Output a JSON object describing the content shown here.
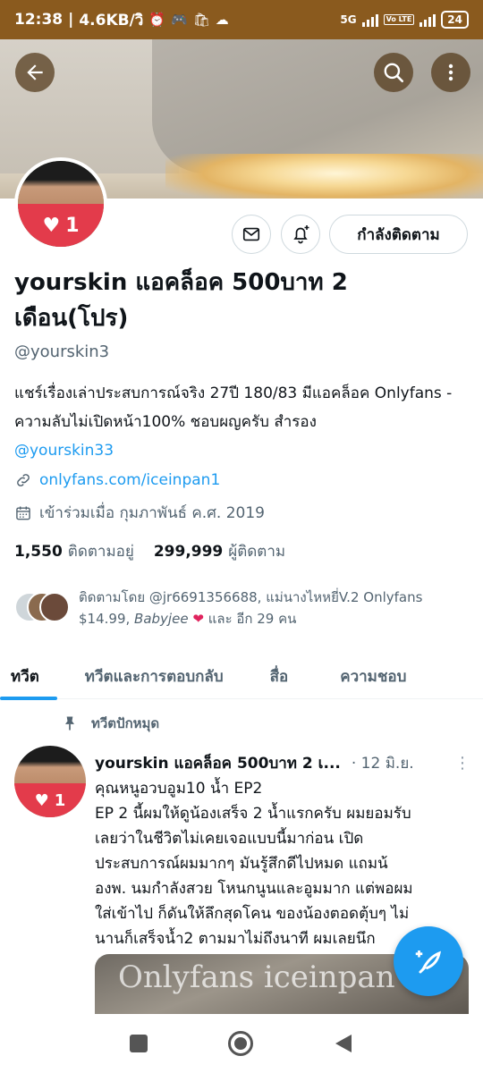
{
  "status_bar": {
    "time": "12:38",
    "data_speed": "4.6KB/วิ",
    "network_label": "5G",
    "volte_label": "Vo LTE",
    "battery": "24"
  },
  "profile": {
    "display_name": "yourskin แอคล็อค 500บาท 2 เดือน(โปร)",
    "handle": "@yourskin3",
    "bio_text": "แชร์เรื่องเล่าประสบการณ์จริง 27ปี 180/83 มีแอคล็อค Onlyfans - ความลับไม่เปิดหน้า100% ชอบผญครับ สำรอง",
    "bio_mention": "@yourskin33",
    "website": "onlyfans.com/iceinpan1",
    "joined": "เข้าร่วมเมื่อ กุมภาพันธ์ ค.ศ. 2019",
    "following_count": "1,550",
    "following_label": "ติดตามอยู่",
    "followers_count": "299,999",
    "followers_label": "ผู้ติดตาม",
    "avatar_badge": "1",
    "following_button": "กำลังติดตาม"
  },
  "followed_by": {
    "prefix": "ติดตามโดย @jr6691356688, แม่นางไหหยี่V.2 Onlyfans $14.99,",
    "name3": "Babyjee",
    "heart": "❤",
    "suffix": "และ อีก 29 คน"
  },
  "tabs": [
    {
      "label": "ทวีต"
    },
    {
      "label": "ทวีตและการตอบกลับ"
    },
    {
      "label": "สื่อ"
    },
    {
      "label": "ความชอบ"
    }
  ],
  "pinned_label": "ทวีตปักหมุด",
  "tweet": {
    "author": "yourskin แอคล็อค 500บาท 2 เ...",
    "date": "· 12 มิ.ย.",
    "more": "⋮",
    "lines": [
      "คุณหนูอวบอูม10 น้ำ EP2",
      "EP 2 นี้ผมให้ดูน้องเสร็จ 2 น้ำแรกครับ ผมยอมรับ",
      "เลยว่าในชีวิตไม่เคยเจอแบบนี้มาก่อน เปิด",
      "ประสบการณ์ผมมากๆ มันรู้สึกดีไปหมด แถมน้",
      "องพ. นมกำลังสวย โหนกนูนและอูมมาก แต่พอผม",
      "ใส่เข้าไป ก็ดันให้ลึกสุดโคน ของน้องตอดตุ้บๆ ไม่",
      "นานก็เสร็จน้ำ2 ตามมาไม่ถึงนาที ผมเลยนึก"
    ],
    "media_watermark": "Onlyfans iceinpan",
    "badge": "1"
  },
  "icons": {
    "back": "back-arrow-icon",
    "search": "search-icon",
    "more": "more-vertical-icon",
    "message": "envelope-icon",
    "notify": "bell-plus-icon",
    "link": "link-icon",
    "calendar": "calendar-icon",
    "pin": "pin-icon",
    "compose": "compose-feather-icon"
  },
  "colors": {
    "accent": "#1d9bf0",
    "status_bar": "#8a5a1e",
    "heart_badge": "#e33b4b"
  }
}
